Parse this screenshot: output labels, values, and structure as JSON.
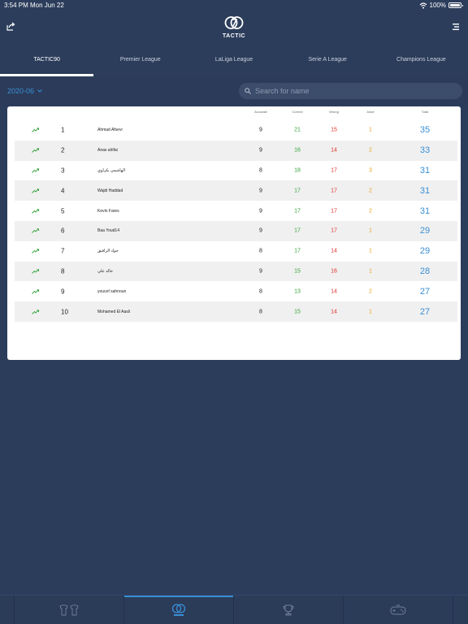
{
  "status_bar": {
    "time": "3:54 PM",
    "date": "Mon Jun 22",
    "battery": "100%"
  },
  "header": {
    "logo_text": "TACTIC"
  },
  "tabs": [
    {
      "label": "TACTIC90",
      "active": true
    },
    {
      "label": "Premier League",
      "active": false
    },
    {
      "label": "LaLiga League",
      "active": false
    },
    {
      "label": "Serie A League",
      "active": false
    },
    {
      "label": "Champions League",
      "active": false
    }
  ],
  "filter": {
    "month": "2020-06",
    "search_placeholder": "Search for name"
  },
  "table": {
    "headers": {
      "accurate": "Accurate",
      "correct": "Correct",
      "wrong": "Wrong",
      "joker": "Joker",
      "total": "Total"
    },
    "rows": [
      {
        "rank": "1",
        "name": "Ahmad Afsevi",
        "accurate": "9",
        "correct": "21",
        "wrong": "15",
        "joker": "1",
        "total": "35"
      },
      {
        "rank": "2",
        "name": "Anas alrifai",
        "accurate": "9",
        "correct": "16",
        "wrong": "14",
        "joker": "2",
        "total": "33"
      },
      {
        "rank": "3",
        "name": "الهاشمي بكراوي",
        "accurate": "8",
        "correct": "18",
        "wrong": "17",
        "joker": "3",
        "total": "31"
      },
      {
        "rank": "4",
        "name": "Wajdi Haddad",
        "accurate": "9",
        "correct": "17",
        "wrong": "17",
        "joker": "2",
        "total": "31"
      },
      {
        "rank": "5",
        "name": "Kevin Fares",
        "accurate": "9",
        "correct": "17",
        "wrong": "17",
        "joker": "2",
        "total": "31"
      },
      {
        "rank": "6",
        "name": "Baa Youd14",
        "accurate": "9",
        "correct": "17",
        "wrong": "17",
        "joker": "1",
        "total": "29"
      },
      {
        "rank": "7",
        "name": "جواد الزافيق",
        "accurate": "8",
        "correct": "17",
        "wrong": "14",
        "joker": "1",
        "total": "29"
      },
      {
        "rank": "8",
        "name": "خالد علي",
        "accurate": "9",
        "correct": "15",
        "wrong": "16",
        "joker": "1",
        "total": "28"
      },
      {
        "rank": "9",
        "name": "youcef sahnoun",
        "accurate": "8",
        "correct": "13",
        "wrong": "14",
        "joker": "2",
        "total": "27"
      },
      {
        "rank": "10",
        "name": "Mohamed El Aasli",
        "accurate": "8",
        "correct": "15",
        "wrong": "14",
        "joker": "1",
        "total": "27"
      }
    ]
  },
  "bottom_nav": [
    {
      "icon": "jerseys-icon",
      "active": false
    },
    {
      "icon": "tactic-logo-icon",
      "active": true
    },
    {
      "icon": "trophy-icon",
      "active": false
    },
    {
      "icon": "controller-icon",
      "active": false
    }
  ],
  "colors": {
    "background": "#2c3d5b",
    "accent_blue": "#3a8fd6",
    "correct_green": "#2fa236",
    "wrong_red": "#e0302e",
    "joker_orange": "#e6a21e"
  }
}
